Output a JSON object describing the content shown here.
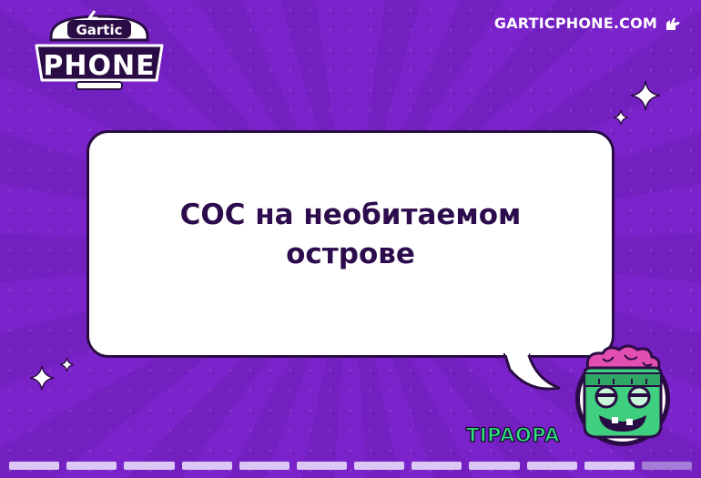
{
  "header": {
    "logo_text_top": "Gartic",
    "logo_text_main": "PHONE",
    "site_label": "GARTICPHONE.COM",
    "site_icon": "hand-pointer-icon"
  },
  "prompt": {
    "text": "СОС на необитаемом острове"
  },
  "player": {
    "name": "TIPAOPA",
    "avatar": "zombie-avatar-icon"
  },
  "progress": {
    "total_segments": 12,
    "completed_segments": 11
  },
  "colors": {
    "background": "#7a22c9",
    "prompt_text": "#2c0c4c",
    "player_name": "#2de47f"
  }
}
